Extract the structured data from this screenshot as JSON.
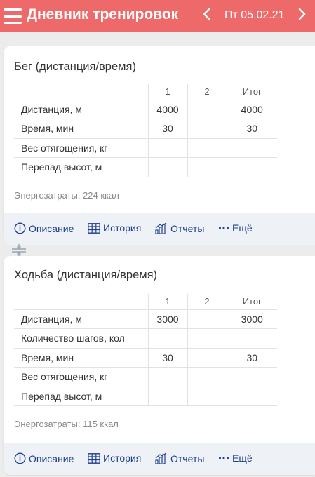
{
  "header": {
    "title": "Дневник тренировок",
    "date": "Пт 05.02.21",
    "prev_label": "‹",
    "next_label": "›",
    "bg_color": "#ee6a6a"
  },
  "columns": [
    "1",
    "2",
    "Итог"
  ],
  "exercises": [
    {
      "title": "Бег (дистанция/время)",
      "rows": [
        {
          "label": "Дистанция, м",
          "c1": "4000",
          "c2": "",
          "total": "4000"
        },
        {
          "label": "Время, мин",
          "c1": "30",
          "c2": "",
          "total": "30"
        },
        {
          "label": "Вес отягощения, кг",
          "c1": "",
          "c2": "",
          "total": ""
        },
        {
          "label": "Перепад высот, м",
          "c1": "",
          "c2": "",
          "total": ""
        }
      ],
      "energy": "Энергозатраты: 224 ккал"
    },
    {
      "title": "Ходьба (дистанция/время)",
      "rows": [
        {
          "label": "Дистанция, м",
          "c1": "3000",
          "c2": "",
          "total": "3000"
        },
        {
          "label": "Количество шагов, кол",
          "c1": "",
          "c2": "",
          "total": ""
        },
        {
          "label": "Время, мин",
          "c1": "30",
          "c2": "",
          "total": "30"
        },
        {
          "label": "Вес отягощения, кг",
          "c1": "",
          "c2": "",
          "total": ""
        },
        {
          "label": "Перепад высот, м",
          "c1": "",
          "c2": "",
          "total": ""
        }
      ],
      "energy": "Энергозатраты: 115 ккал"
    }
  ],
  "actions": {
    "description": "Описание",
    "history": "История",
    "reports": "Отчеты",
    "more": "Ещё"
  },
  "accent_color": "#1f3f8f"
}
